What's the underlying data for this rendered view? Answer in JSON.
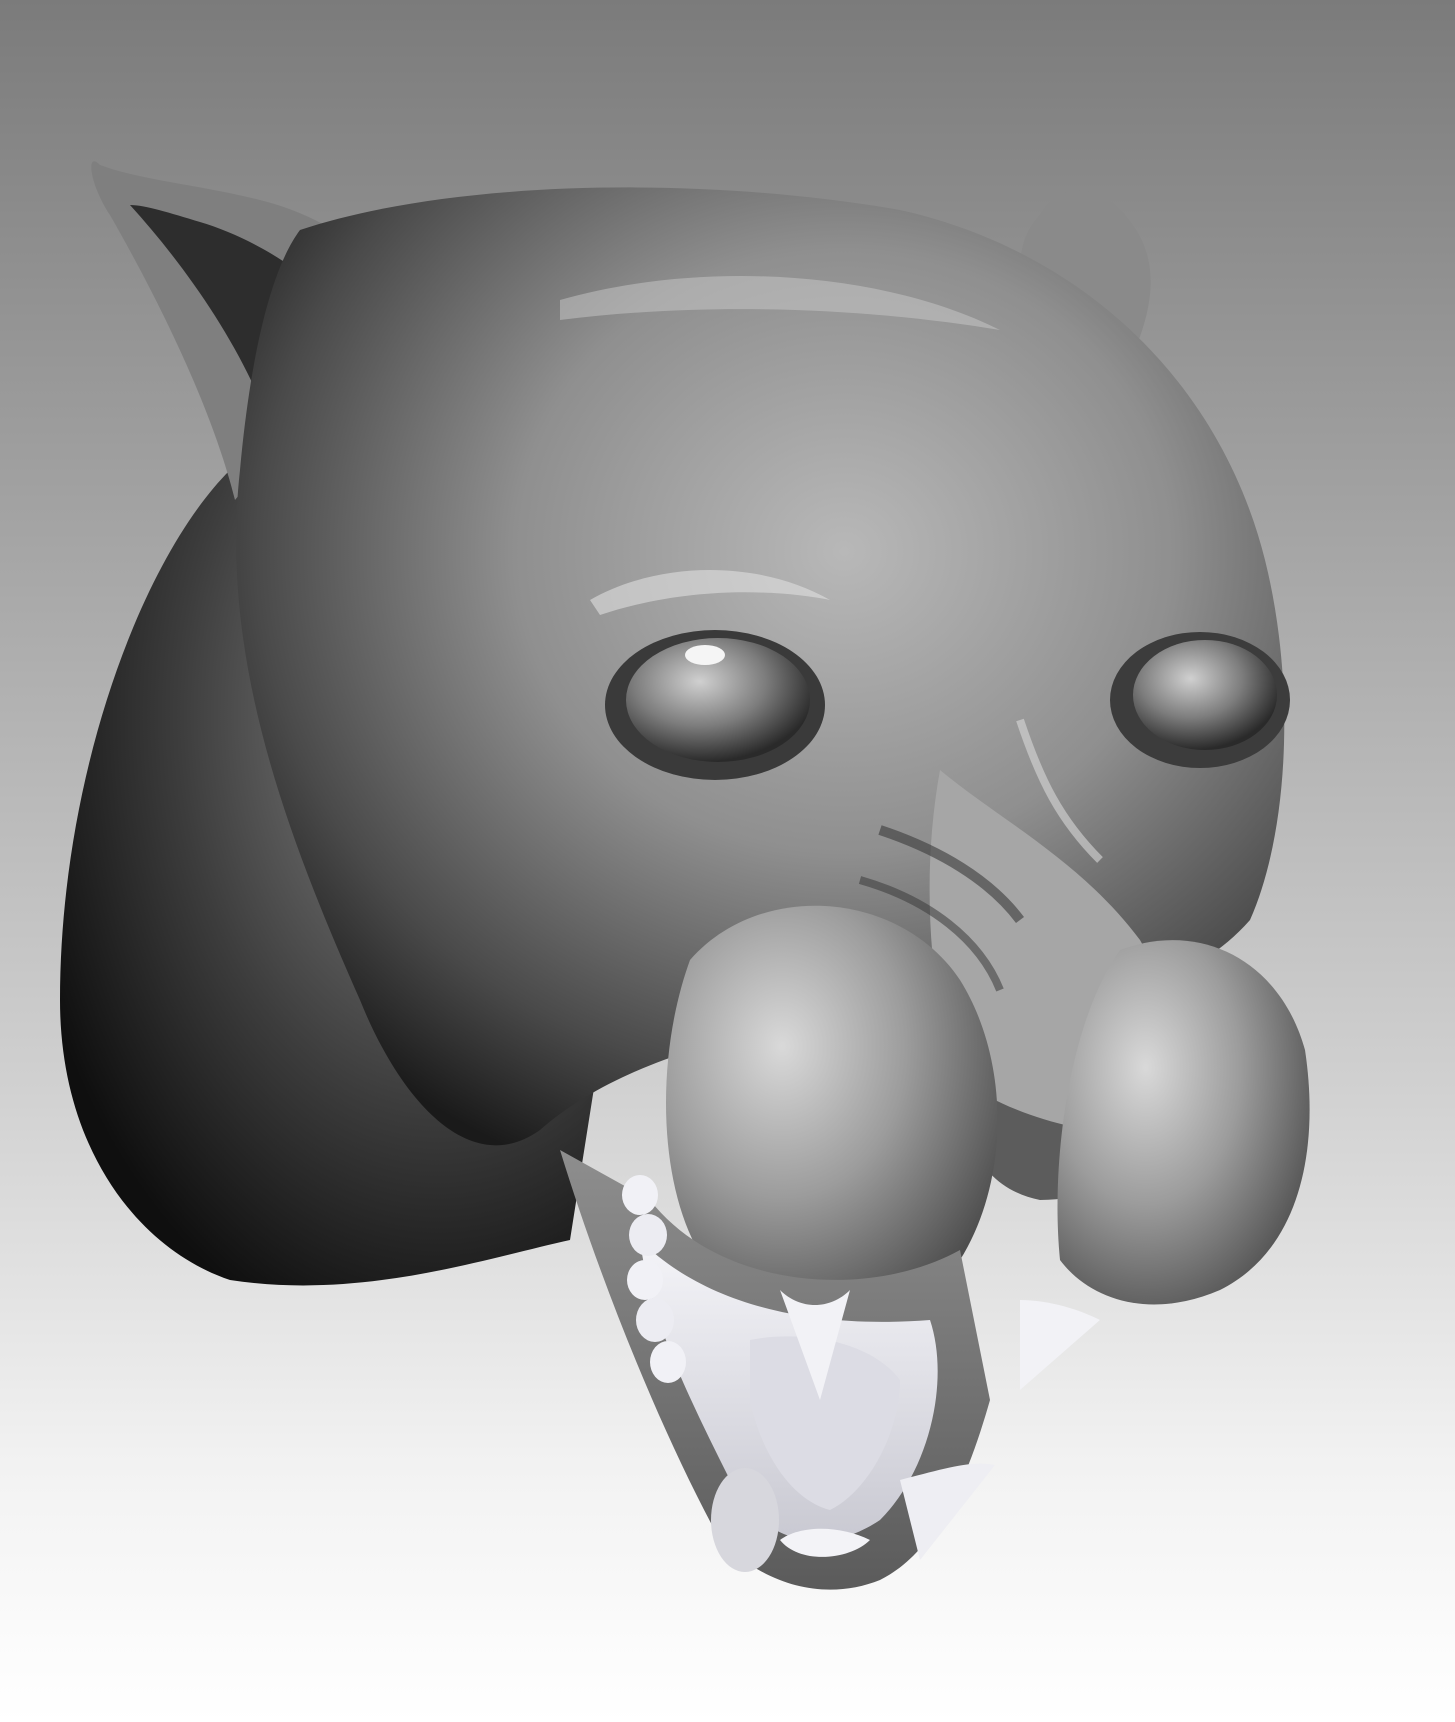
{
  "scene": {
    "background_top": "#7b7b7b",
    "background_bottom": "#ffffff",
    "material_base": "#9a9a9a",
    "material_highlight": "#e6e6e6",
    "material_shadow": "#1e1e1e",
    "teeth_color": "#ececf2"
  }
}
